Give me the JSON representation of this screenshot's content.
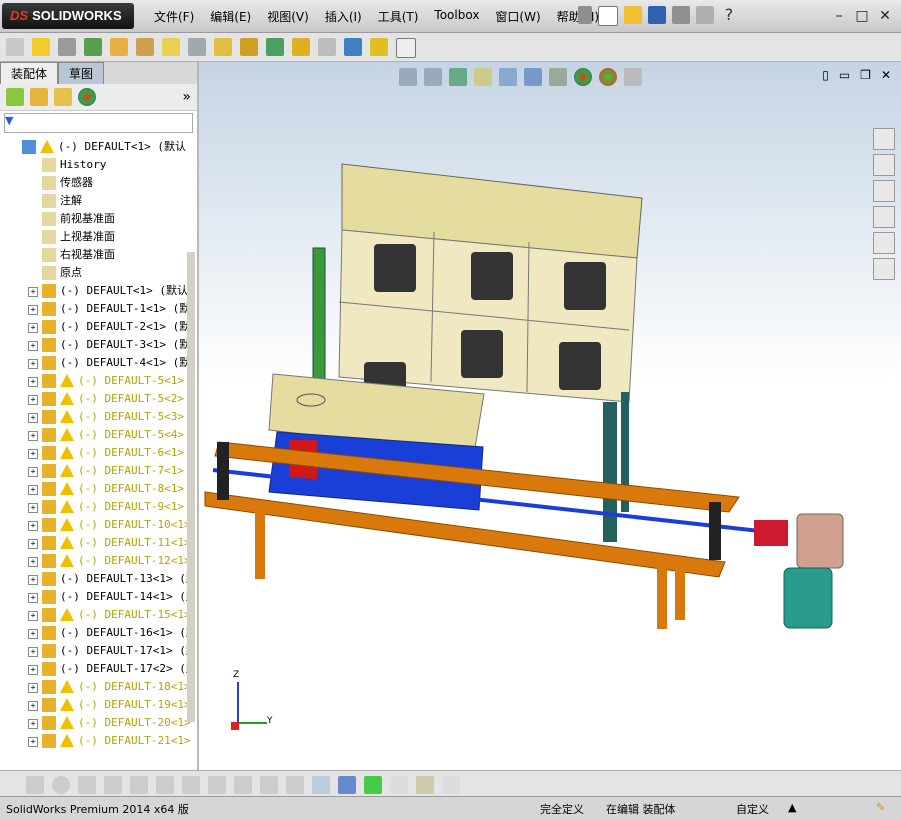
{
  "app": {
    "brand": "SOLIDWORKS"
  },
  "menu": [
    "文件(F)",
    "编辑(E)",
    "视图(V)",
    "插入(I)",
    "工具(T)",
    "Toolbox",
    "窗口(W)",
    "帮助(H)"
  ],
  "fm_tabs": [
    "装配体",
    "草图"
  ],
  "tree": {
    "root": "(-) DEFAULT<1> (默认",
    "fixed": [
      "History",
      "传感器",
      "注解",
      "前视基准面",
      "上视基准面",
      "右视基准面",
      "原点"
    ],
    "components": [
      {
        "label": "(-) DEFAULT<1> (默认",
        "warn": false
      },
      {
        "label": "(-) DEFAULT-1<1> (默",
        "warn": false
      },
      {
        "label": "(-) DEFAULT-2<1> (默",
        "warn": false
      },
      {
        "label": "(-) DEFAULT-3<1> (默",
        "warn": false
      },
      {
        "label": "(-) DEFAULT-4<1> (默",
        "warn": false
      },
      {
        "label": "(-) DEFAULT-5<1>",
        "warn": true
      },
      {
        "label": "(-) DEFAULT-5<2>",
        "warn": true
      },
      {
        "label": "(-) DEFAULT-5<3>",
        "warn": true
      },
      {
        "label": "(-) DEFAULT-5<4>",
        "warn": true
      },
      {
        "label": "(-) DEFAULT-6<1>",
        "warn": true
      },
      {
        "label": "(-) DEFAULT-7<1>",
        "warn": true
      },
      {
        "label": "(-) DEFAULT-8<1>",
        "warn": true
      },
      {
        "label": "(-) DEFAULT-9<1>",
        "warn": true
      },
      {
        "label": "(-) DEFAULT-10<1>",
        "warn": true
      },
      {
        "label": "(-) DEFAULT-11<1>",
        "warn": true
      },
      {
        "label": "(-) DEFAULT-12<1>",
        "warn": true
      },
      {
        "label": "(-) DEFAULT-13<1> (默",
        "warn": false
      },
      {
        "label": "(-) DEFAULT-14<1> (默",
        "warn": false
      },
      {
        "label": "(-) DEFAULT-15<1>",
        "warn": true
      },
      {
        "label": "(-) DEFAULT-16<1> (默",
        "warn": false
      },
      {
        "label": "(-) DEFAULT-17<1> (默",
        "warn": false
      },
      {
        "label": "(-) DEFAULT-17<2> (默",
        "warn": false
      },
      {
        "label": "(-) DEFAULT-18<1>",
        "warn": true
      },
      {
        "label": "(-) DEFAULT-19<1>",
        "warn": true
      },
      {
        "label": "(-) DEFAULT-20<1>",
        "warn": true
      },
      {
        "label": "(-) DEFAULT-21<1>",
        "warn": true
      }
    ]
  },
  "status": {
    "product": "SolidWorks Premium 2014 x64 版",
    "defined": "完全定义",
    "editing": "在编辑 装配体",
    "custom": "自定义"
  },
  "triad": {
    "x": "Y",
    "z": "Z"
  },
  "colors": {
    "accent": "#1a3fd8",
    "frame": "#d9790c",
    "panel": "#e5dca0",
    "motor": "#d0a090"
  }
}
